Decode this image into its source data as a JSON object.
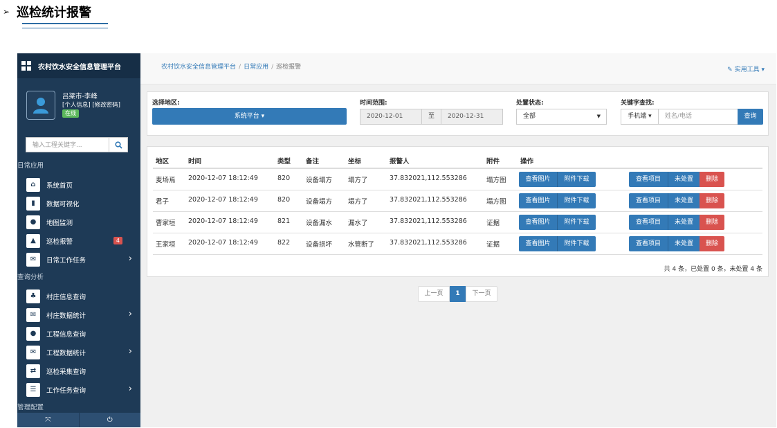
{
  "doc": {
    "title": "巡检统计报警",
    "arrow": "➢"
  },
  "sidebar": {
    "brand": "农村饮水安全信息管理平台",
    "user": {
      "name": "吕梁市-李峰",
      "links": "[个人信息] [修改密码]",
      "status": "在线"
    },
    "search_placeholder": "输入工程关键字...",
    "section1": "日常应用",
    "items1": [
      {
        "label": "系统首页",
        "icon": "home-icon",
        "glyph": "⌂"
      },
      {
        "label": "数据可视化",
        "icon": "bar-chart-icon",
        "glyph": "▮"
      },
      {
        "label": "地图监测",
        "icon": "map-marker-icon",
        "glyph": "●"
      },
      {
        "label": "巡检报警",
        "icon": "warning-icon",
        "glyph": "▲",
        "badge": "4"
      },
      {
        "label": "日常工作任务",
        "icon": "envelope-icon",
        "glyph": "✉",
        "chevron": "›"
      }
    ],
    "section2": "查询分析",
    "items2": [
      {
        "label": "村庄信息查询",
        "icon": "tree-icon",
        "glyph": "♣"
      },
      {
        "label": "村庄数据统计",
        "icon": "envelope-icon",
        "glyph": "✉",
        "chevron": "›"
      },
      {
        "label": "工程信息查询",
        "icon": "water-drop-icon",
        "glyph": "●"
      },
      {
        "label": "工程数据统计",
        "icon": "envelope-icon",
        "glyph": "✉",
        "chevron": "›"
      },
      {
        "label": "巡检采集查询",
        "icon": "exchange-icon",
        "glyph": "⇄"
      },
      {
        "label": "工作任务查询",
        "icon": "tasks-icon",
        "glyph": "☰",
        "chevron": "›"
      }
    ],
    "section3": "管理配置",
    "bottom": {
      "expand_glyph": "⤧",
      "power_glyph": "⏻"
    }
  },
  "breadcrumb": [
    "农村饮水安全信息管理平台",
    "日常应用",
    "巡检报警"
  ],
  "tools_label": "实用工具",
  "filters": {
    "region_label": "选择地区:",
    "region_value": "系统平台",
    "time_label": "时间范围:",
    "date_from": "2020-12-01",
    "date_sep": "至",
    "date_to": "2020-12-31",
    "status_label": "处置状态:",
    "status_value": "全部",
    "keyword_label": "关键字查找:",
    "keyword_type": "手机端",
    "keyword_placeholder": "姓名/电话",
    "query_label": "查询"
  },
  "table": {
    "headers": [
      "地区",
      "时间",
      "类型",
      "备注",
      "坐标",
      "报警人",
      "附件",
      "操作"
    ],
    "rows": [
      [
        "麦场焉",
        "2020-12-07 18:12:49",
        "820",
        "设备塌方",
        "塌方了",
        "37.832021,112.553286",
        "塌方图"
      ],
      [
        "君子",
        "2020-12-07 18:12:49",
        "820",
        "设备塌方",
        "塌方了",
        "37.832021,112.553286",
        "塌方图"
      ],
      [
        "曹家垣",
        "2020-12-07 18:12:49",
        "821",
        "设备漏水",
        "漏水了",
        "37.832021,112.553286",
        "证据"
      ],
      [
        "王家垣",
        "2020-12-07 18:12:49",
        "822",
        "设备损坏",
        "水管断了",
        "37.832021,112.553286",
        "证据"
      ]
    ],
    "actions": {
      "view_image": "查看图片",
      "download": "附件下载",
      "view_project": "查看项目",
      "status": "未处置",
      "delete": "删除"
    },
    "summary": "共 4 条，已处置 0 条，未处置 4 条"
  },
  "pager": {
    "prev": "上一页",
    "current": "1",
    "next": "下一页"
  }
}
